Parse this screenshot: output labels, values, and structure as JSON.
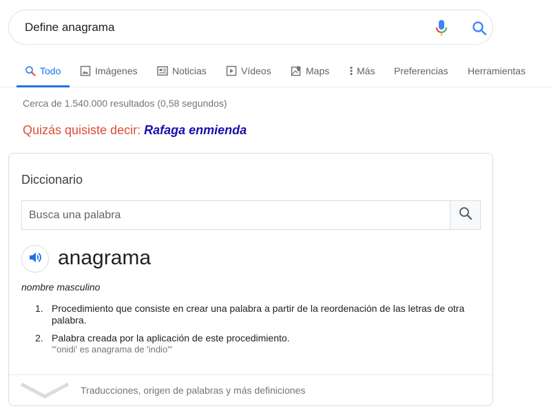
{
  "search": {
    "query": "Define anagrama"
  },
  "tabs": [
    {
      "label": "Todo",
      "icon": "search-icon",
      "active": true
    },
    {
      "label": "Imágenes",
      "icon": "image-icon"
    },
    {
      "label": "Noticias",
      "icon": "news-icon"
    },
    {
      "label": "Vídeos",
      "icon": "video-icon"
    },
    {
      "label": "Maps",
      "icon": "map-icon"
    },
    {
      "label": "Más",
      "icon": "more-vert-icon"
    },
    {
      "label": "Preferencias"
    },
    {
      "label": "Herramientas"
    }
  ],
  "result_stats": "Cerca de 1.540.000 resultados (0,58 segundos)",
  "spell": {
    "lead": "Quizás quisiste decir: ",
    "suggestion": "Rafaga enmienda"
  },
  "dictionary": {
    "title": "Diccionario",
    "search_placeholder": "Busca una palabra",
    "word": "anagrama",
    "part_of_speech": "nombre masculino",
    "definitions": [
      {
        "num": "1.",
        "text": "Procedimiento que consiste en crear una palabra a partir de la reordenación de las letras de otra palabra."
      },
      {
        "num": "2.",
        "text": "Palabra creada por la aplicación de este procedimiento.",
        "example": "\"'onidi' es anagrama de 'indio'\""
      }
    ],
    "footer": "Traducciones, origen de palabras y más definiciones"
  },
  "colors": {
    "accent": "#1a73e8",
    "link": "#1a0dab",
    "spell_lead": "#dd4b39"
  }
}
